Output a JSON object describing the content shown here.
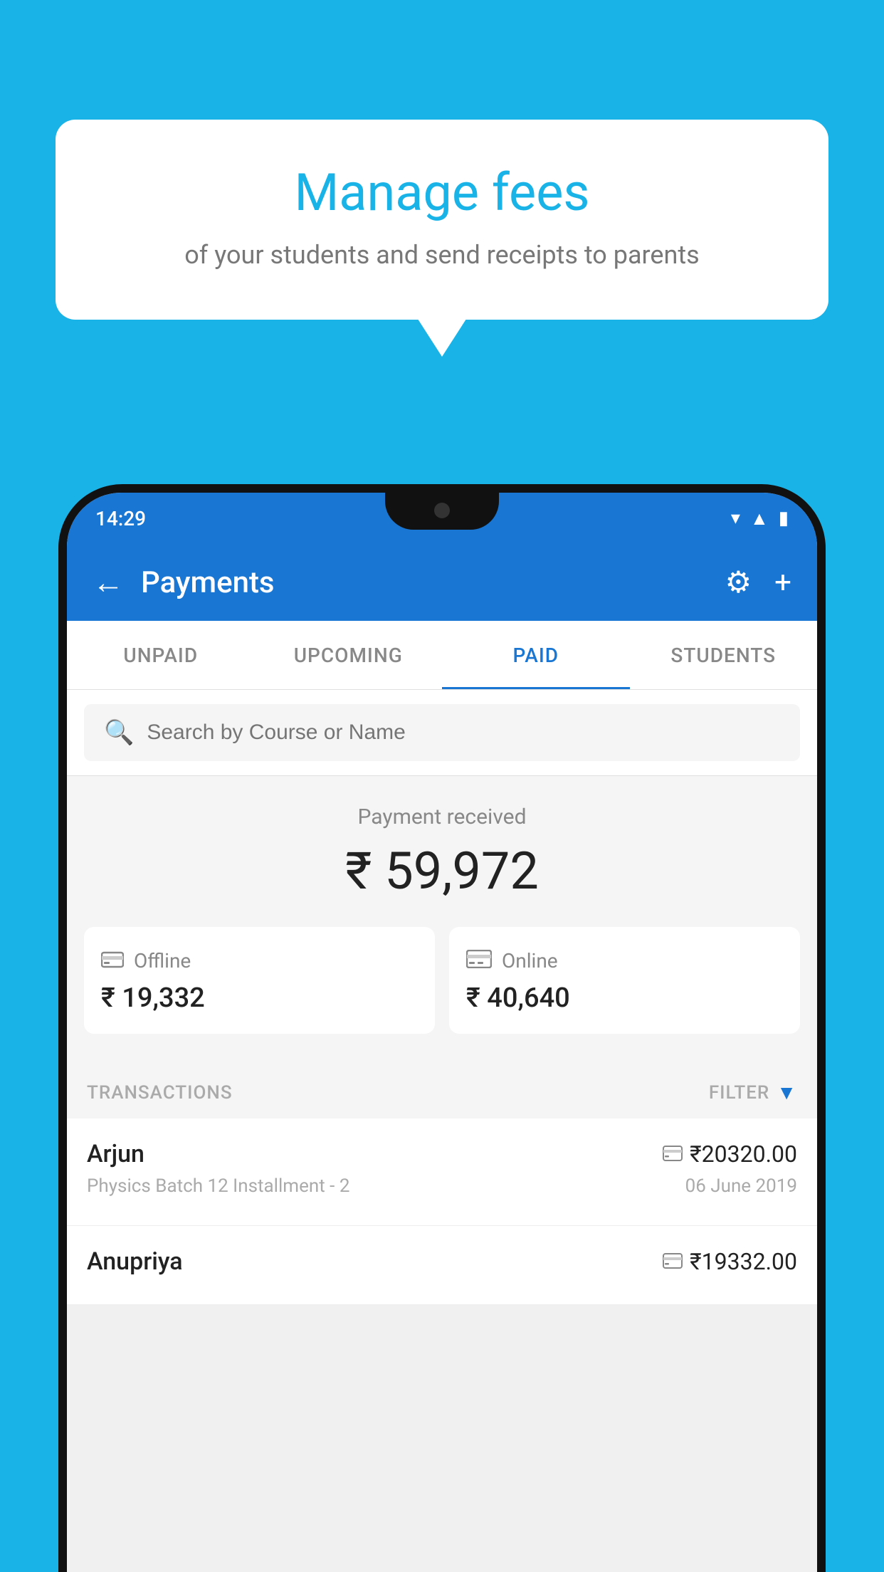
{
  "background_color": "#1ab3e8",
  "bubble": {
    "title": "Manage fees",
    "subtitle": "of your students and send receipts to parents"
  },
  "status_bar": {
    "time": "14:29",
    "wifi_icon": "▾",
    "signal_icon": "▲",
    "battery_icon": "▮"
  },
  "app_bar": {
    "title": "Payments",
    "back_label": "←",
    "settings_label": "⚙",
    "add_label": "+"
  },
  "tabs": [
    {
      "id": "unpaid",
      "label": "UNPAID",
      "active": false
    },
    {
      "id": "upcoming",
      "label": "UPCOMING",
      "active": false
    },
    {
      "id": "paid",
      "label": "PAID",
      "active": true
    },
    {
      "id": "students",
      "label": "STUDENTS",
      "active": false
    }
  ],
  "search": {
    "placeholder": "Search by Course or Name"
  },
  "payment_received": {
    "label": "Payment received",
    "amount": "₹ 59,972",
    "offline": {
      "icon": "💳",
      "label": "Offline",
      "amount": "₹ 19,332"
    },
    "online": {
      "icon": "💳",
      "label": "Online",
      "amount": "₹ 40,640"
    }
  },
  "transactions_section": {
    "label": "TRANSACTIONS",
    "filter_label": "FILTER"
  },
  "transactions": [
    {
      "name": "Arjun",
      "description": "Physics Batch 12 Installment - 2",
      "amount": "₹20320.00",
      "date": "06 June 2019",
      "payment_type": "online"
    },
    {
      "name": "Anupriya",
      "description": "",
      "amount": "₹19332.00",
      "date": "",
      "payment_type": "offline"
    }
  ]
}
